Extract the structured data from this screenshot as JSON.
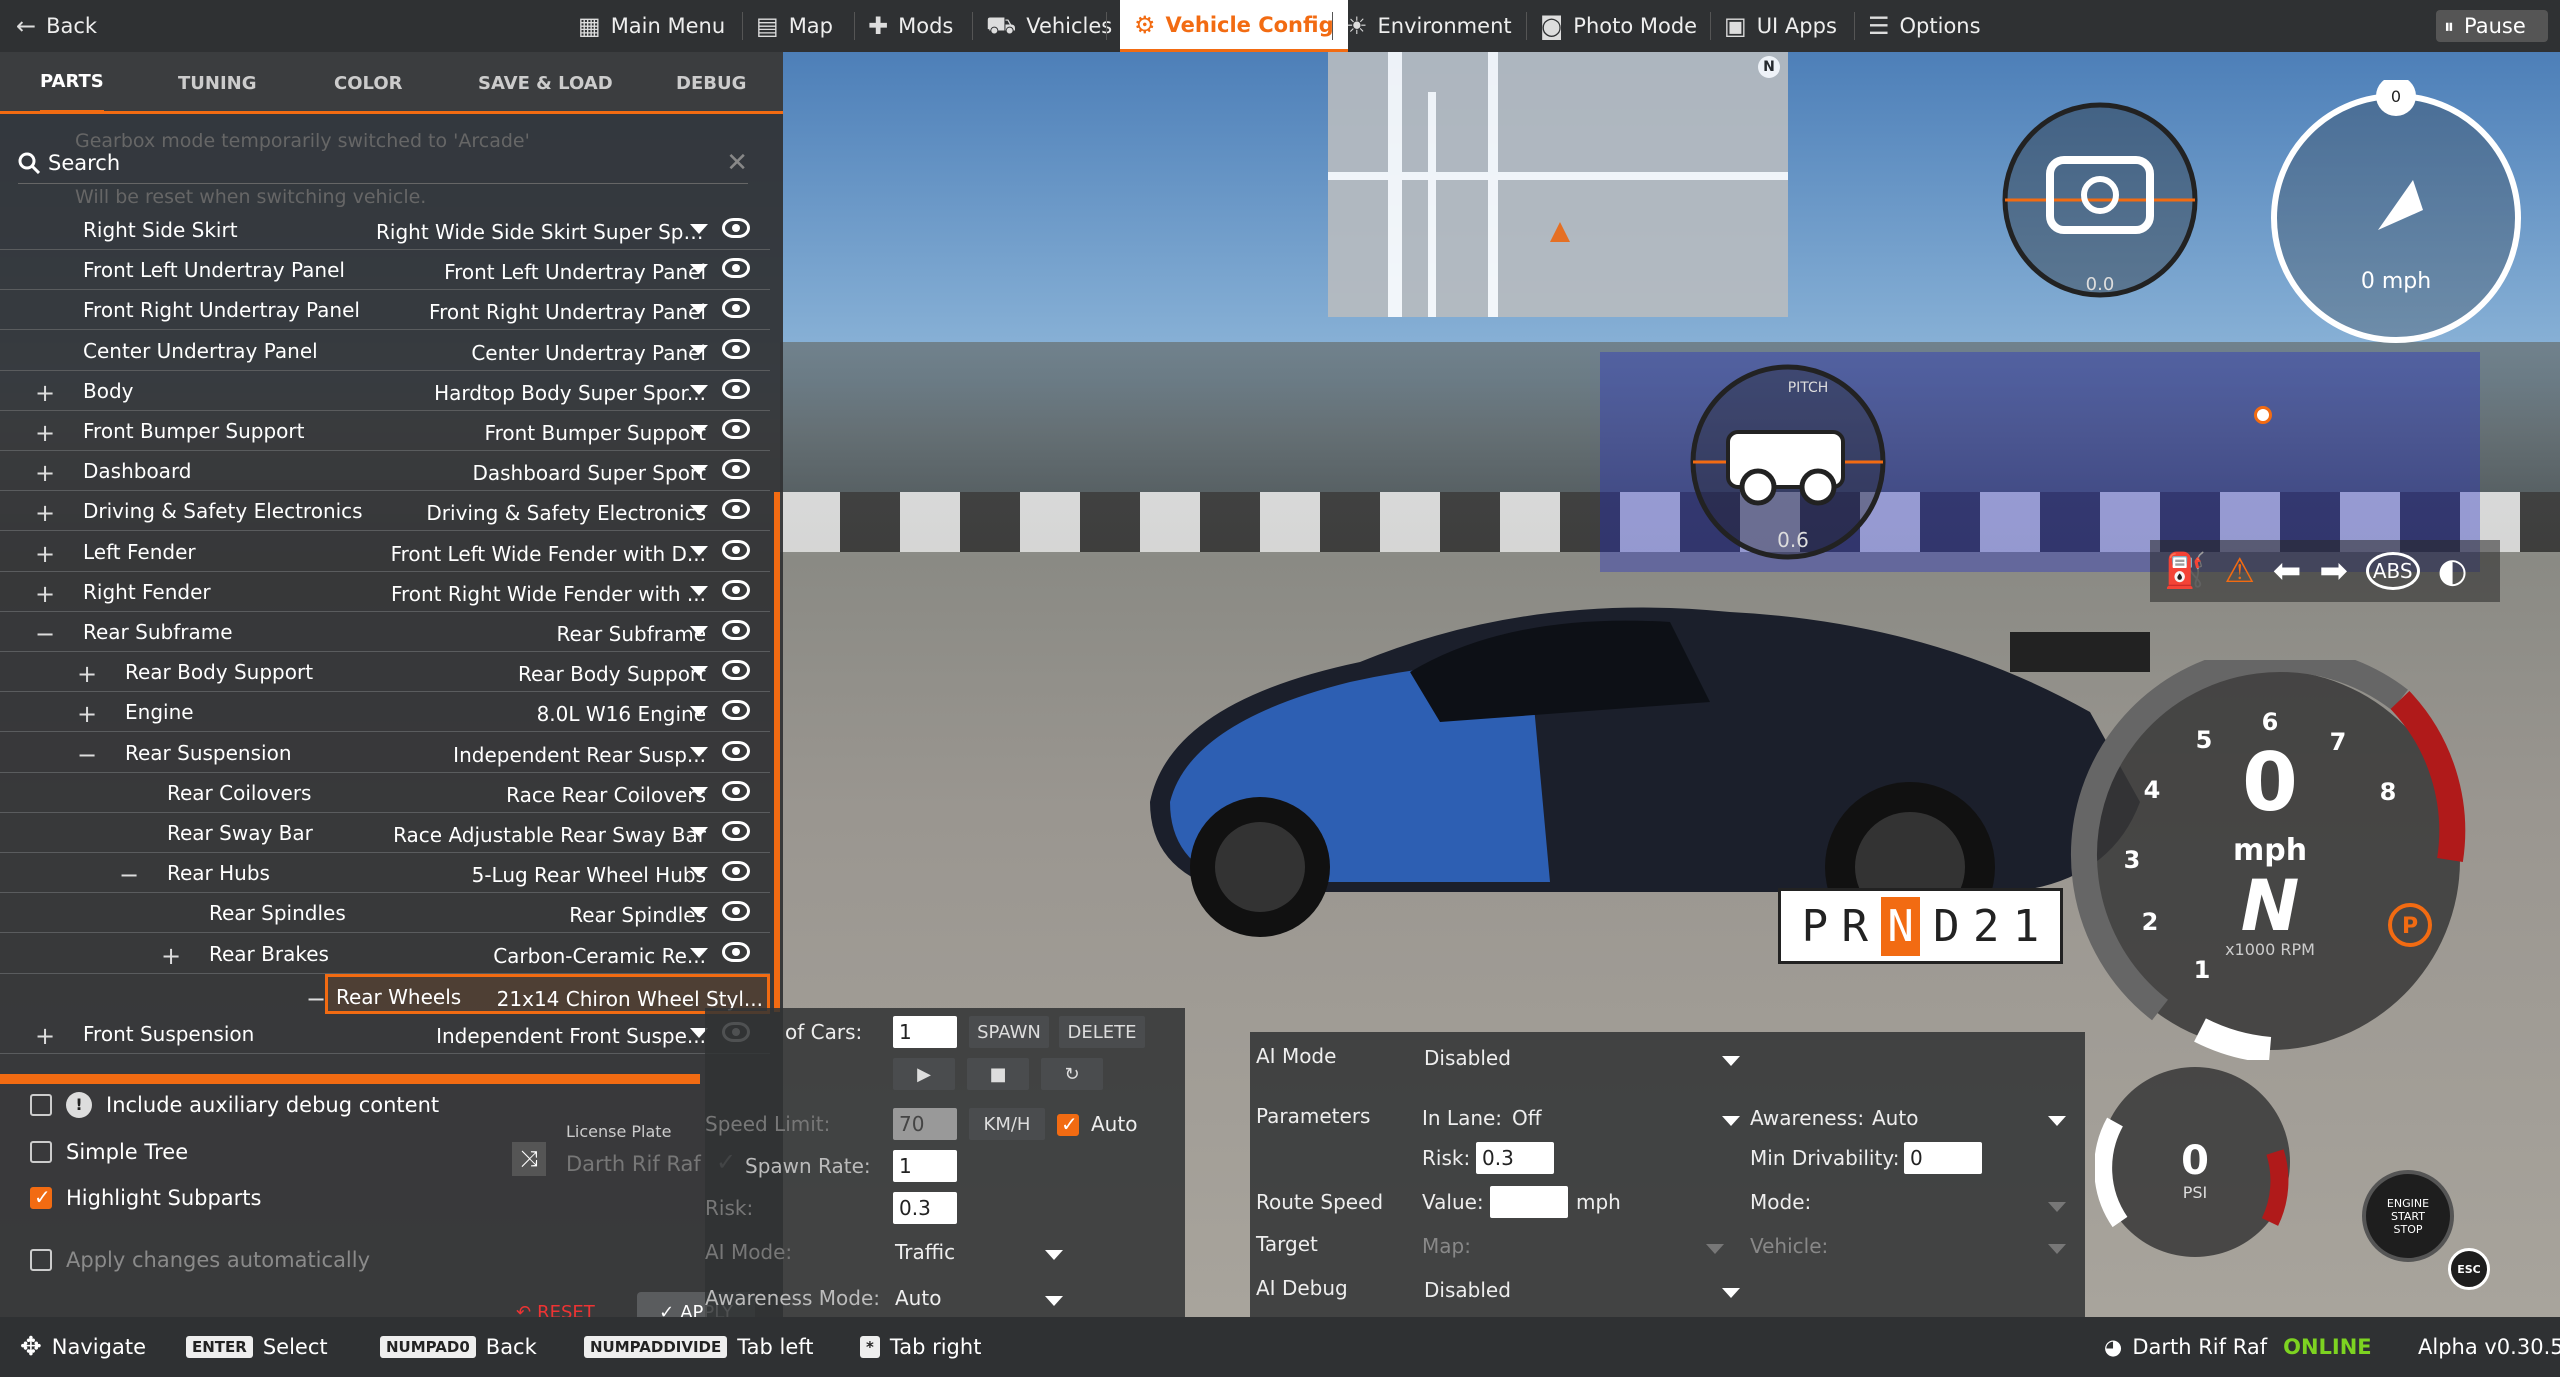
{
  "topbar": {
    "back": "Back",
    "items": [
      {
        "label": "Main Menu",
        "icon": "grid-icon"
      },
      {
        "label": "Map",
        "icon": "map-icon"
      },
      {
        "label": "Mods",
        "icon": "puzzle-icon"
      },
      {
        "label": "Vehicles",
        "icon": "car-icon"
      },
      {
        "label": "Vehicle Config",
        "icon": "engine-icon",
        "active": true
      },
      {
        "label": "Environment",
        "icon": "sun-icon"
      },
      {
        "label": "Photo Mode",
        "icon": "camera-icon"
      },
      {
        "label": "UI Apps",
        "icon": "apps-icon"
      },
      {
        "label": "Options",
        "icon": "sliders-icon"
      }
    ],
    "pause": "Pause",
    "accent": "#f26b12"
  },
  "panel": {
    "tabs": [
      "PARTS",
      "TUNING",
      "COLOR",
      "SAVE & LOAD",
      "DEBUG"
    ],
    "search_label": "Search",
    "background_messages": [
      "Gearbox mode temporarily switched to 'Arcade'",
      "Will be reset when switching vehicle."
    ],
    "rows": [
      {
        "name": "Right Side Skirt",
        "value": "Right Wide Side Skirt Super Sport",
        "toggle": "",
        "depth": 0
      },
      {
        "name": "Front Left Undertray Panel",
        "value": "Front Left Undertray Panel",
        "toggle": "",
        "depth": 0
      },
      {
        "name": "Front Right Undertray Panel",
        "value": "Front Right Undertray Panel",
        "toggle": "",
        "depth": 0
      },
      {
        "name": "Center Undertray Panel",
        "value": "Center Undertray Panel",
        "toggle": "",
        "depth": 0
      },
      {
        "name": "Body",
        "value": "Hardtop Body Super Spor...",
        "toggle": "+",
        "depth": 0
      },
      {
        "name": "Front Bumper Support",
        "value": "Front Bumper Support",
        "toggle": "+",
        "depth": 0
      },
      {
        "name": "Dashboard",
        "value": "Dashboard Super Sport",
        "toggle": "+",
        "depth": 0
      },
      {
        "name": "Driving & Safety Electronics",
        "value": "Driving & Safety Electronics",
        "toggle": "+",
        "depth": 0
      },
      {
        "name": "Left Fender",
        "value": "Front Left Wide Fender with D...",
        "toggle": "+",
        "depth": 0
      },
      {
        "name": "Right Fender",
        "value": "Front Right Wide Fender with ...",
        "toggle": "+",
        "depth": 0
      },
      {
        "name": "Rear Subframe",
        "value": "Rear Subframe",
        "toggle": "−",
        "depth": 0
      },
      {
        "name": "Rear Body Support",
        "value": "Rear Body Support",
        "toggle": "+",
        "depth": 1
      },
      {
        "name": "Engine",
        "value": "8.0L W16 Engine",
        "toggle": "+",
        "depth": 1
      },
      {
        "name": "Rear Suspension",
        "value": "Independent Rear Susp...",
        "toggle": "−",
        "depth": 1
      },
      {
        "name": "Rear Coilovers",
        "value": "Race Rear Coilovers",
        "toggle": "",
        "depth": 2
      },
      {
        "name": "Rear Sway Bar",
        "value": "Race Adjustable Rear Sway Bar",
        "toggle": "",
        "depth": 2
      },
      {
        "name": "Rear Hubs",
        "value": "5-Lug Rear Wheel Hubs",
        "toggle": "−",
        "depth": 2
      },
      {
        "name": "Rear Spindles",
        "value": "Rear Spindles",
        "toggle": "",
        "depth": 3
      },
      {
        "name": "Rear Brakes",
        "value": "Carbon-Ceramic Re...",
        "toggle": "+",
        "depth": 3
      },
      {
        "name": "Rear Wheels",
        "value": "21x14 Chiron Wheel Styl...",
        "toggle": "−",
        "depth": 3,
        "selected": true
      },
      {
        "name": "Front Suspension",
        "value": "Independent Front Suspe...",
        "toggle": "+",
        "depth": 0
      }
    ],
    "options": [
      {
        "label": "Include auxiliary debug content",
        "checked": false,
        "info": true
      },
      {
        "label": "Simple Tree",
        "checked": false
      },
      {
        "label": "Highlight Subparts",
        "checked": true
      },
      {
        "label": "Apply changes automatically",
        "checked": false,
        "disabled": true
      }
    ],
    "license_plate_label": "License Plate",
    "license_plate_value": "Darth Rif Raf",
    "reset": "RESET",
    "apply": "APPLY"
  },
  "spawn": {
    "cars_label": "of Cars:",
    "cars_value": "1",
    "spawn_btn": "SPAWN",
    "delete_btn": "DELETE",
    "speed_limit_label": "Speed Limit:",
    "speed_limit_value": "70",
    "unit_btn": "KM/H",
    "auto_label": "Auto",
    "spawn_rate_label": "Spawn Rate:",
    "spawn_rate_value": "1",
    "risk_label": "Risk:",
    "risk_value": "0.3",
    "ai_mode_label": "AI Mode:",
    "ai_mode_value": "Traffic",
    "awareness_label": "Awareness Mode:",
    "awareness_value": "Auto"
  },
  "ai": {
    "mode_label": "AI Mode",
    "mode_value": "Disabled",
    "params_label": "Parameters",
    "inlane_label": "In Lane:",
    "inlane_value": "Off",
    "awareness_label": "Awareness:",
    "awareness_value": "Auto",
    "risk_label": "Risk:",
    "risk_value": "0.3",
    "min_drv_label": "Min Drivability:",
    "min_drv_value": "0",
    "route_label": "Route Speed",
    "value_label": "Value:",
    "value_value": "",
    "mph": "mph",
    "mode2_label": "Mode:",
    "target_label": "Target",
    "map_label": "Map:",
    "vehicle_label": "Vehicle:",
    "debug_label": "AI Debug",
    "debug_value": "Disabled"
  },
  "hud": {
    "compass_num": "0",
    "speed_text": "0 mph",
    "tilt_value": "0.0",
    "pitch_value": "0.6",
    "gear_display": [
      "P",
      "R",
      "N",
      "D",
      "2",
      "1"
    ],
    "active_gear": "N",
    "tacho_speed": "0",
    "tacho_unit": "mph",
    "tacho_gear": "N",
    "rpm_label": "x1000 RPM",
    "rpm_ticks": [
      "1",
      "2",
      "3",
      "4",
      "5",
      "6",
      "7",
      "8"
    ],
    "boost_value": "0",
    "boost_unit": "PSI",
    "engine_label": "ENGINE START STOP",
    "esc": "ESC",
    "pitch_label": "PITCH",
    "abs_label": "ABS",
    "park_label": "P"
  },
  "bottombar": {
    "hints": [
      {
        "key": "",
        "label": "Navigate",
        "icon": "dpad-icon"
      },
      {
        "key": "ENTER",
        "label": "Select"
      },
      {
        "key": "NUMPAD0",
        "label": "Back"
      },
      {
        "key": "NUMPADDIVIDE",
        "label": "Tab left"
      },
      {
        "key": "*",
        "label": "Tab right"
      }
    ],
    "user": "Darth Rif Raf",
    "status": "ONLINE",
    "version": "Alpha v0.30.5"
  }
}
